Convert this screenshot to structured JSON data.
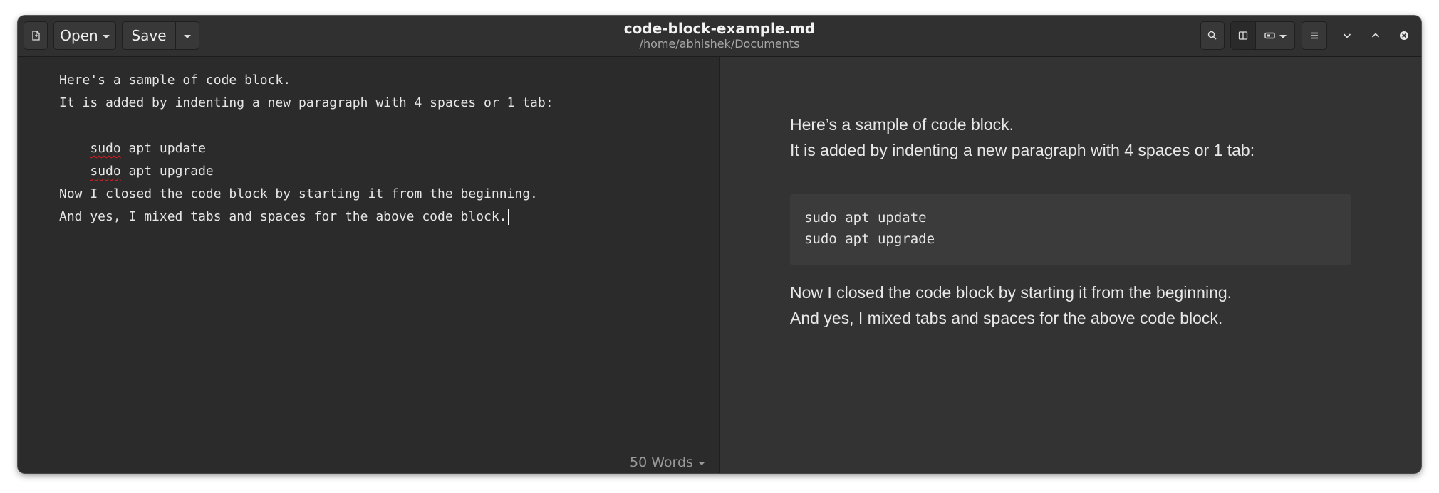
{
  "window": {
    "title": "code-block-example.md",
    "subtitle": "/home/abhishek/Documents"
  },
  "toolbar": {
    "open_label": "Open",
    "save_label": "Save"
  },
  "icons": {
    "new_document": "new-document-icon",
    "search": "search-icon",
    "split_view": "split-view-icon",
    "preview_mode": "preview-mode-icon",
    "menu": "hamburger-menu-icon",
    "minimize": "chevron-down-icon",
    "maximize": "chevron-up-icon",
    "close": "close-icon"
  },
  "editor": {
    "lines": [
      "Here's a sample of code block.",
      "It is added by indenting a new paragraph with 4 spaces or 1 tab:",
      "",
      "    sudo apt update",
      "    sudo apt upgrade",
      "Now I closed the code block by starting it from the beginning.",
      "And yes, I mixed tabs and spaces for the above code block."
    ],
    "code_line_1_word": "sudo",
    "code_line_1_rest": " apt update",
    "code_line_2_word": "sudo",
    "code_line_2_rest": " apt upgrade",
    "word_count": "50 Words"
  },
  "preview": {
    "paragraph1_line1": "Here’s a sample of code block.",
    "paragraph1_line2": "It is added by indenting a new paragraph with 4 spaces or 1 tab:",
    "code_lines": [
      "sudo apt update",
      "sudo apt upgrade"
    ],
    "paragraph2_line1": "Now I closed the code block by starting it from the beginning.",
    "paragraph2_line2": "And yes, I mixed tabs and spaces for the above code block."
  },
  "colors": {
    "window_bg": "#2b2b2b",
    "preview_bg": "#333333",
    "headerbar_bg": "#303030",
    "spellcheck": "#e01b24"
  }
}
